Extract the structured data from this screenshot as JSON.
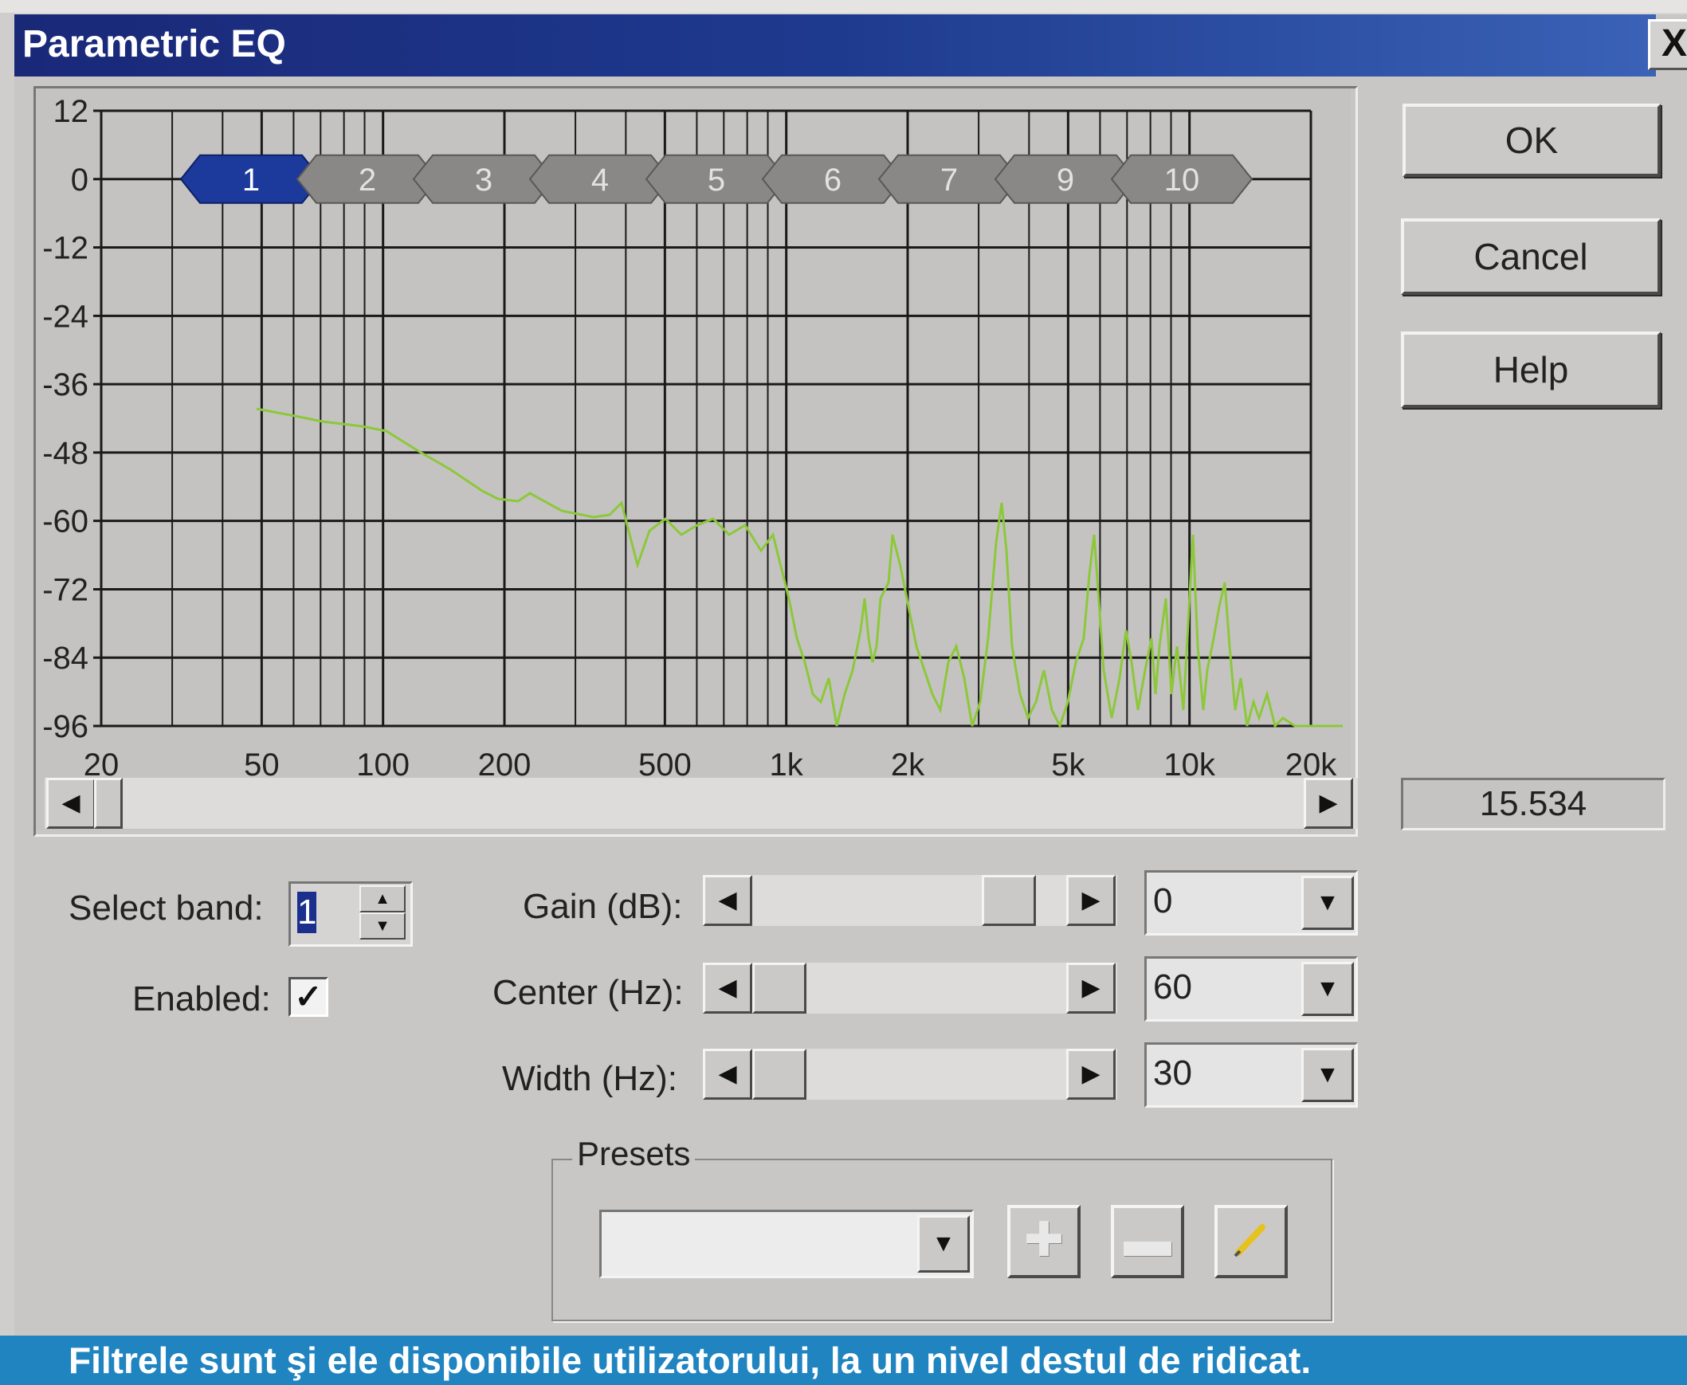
{
  "window": {
    "title": "Parametric EQ",
    "close_label": "X"
  },
  "buttons": {
    "ok": "OK",
    "cancel": "Cancel",
    "help": "Help"
  },
  "graph": {
    "y_labels": [
      "12",
      "0",
      "-12",
      "-24",
      "-36",
      "-48",
      "-60",
      "-72",
      "-84",
      "-96"
    ],
    "x_labels": [
      "20",
      "50",
      "100",
      "200",
      "500",
      "1k",
      "2k",
      "5k",
      "10k",
      "20k"
    ],
    "band_tabs": [
      "1",
      "2",
      "3",
      "4",
      "5",
      "6",
      "7",
      "9",
      "10"
    ],
    "selected_band_tab": "1",
    "colors": {
      "plot_bg": "#c5c3c1",
      "grid": "#1a1a1a",
      "curve": "#8cc83a",
      "band_active": "#1c3a9c",
      "band_inactive": "#8a8886"
    }
  },
  "readout": "15.534",
  "controls": {
    "select_band_label": "Select band:",
    "select_band_value": "1",
    "enabled_label": "Enabled:",
    "enabled_checked": true,
    "gain_label": "Gain (dB):",
    "gain_value": "0",
    "center_label": "Center (Hz):",
    "center_value": "60",
    "width_label": "Width (Hz):",
    "width_value": "30"
  },
  "presets": {
    "label": "Presets",
    "selected": ""
  },
  "caption": "Filtrele sunt şi ele disponibile utilizatorului, la un nivel destul de ridicat."
}
